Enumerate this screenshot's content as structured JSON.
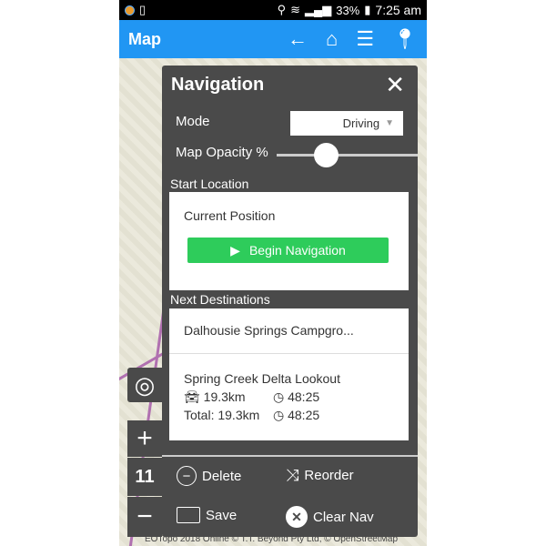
{
  "status_bar": {
    "battery": "33%",
    "time": "7:25 am"
  },
  "app_bar": {
    "title": "Map",
    "icons": [
      "arrow-left-icon",
      "home-icon",
      "list-icon",
      "pin-icon"
    ]
  },
  "navigation": {
    "title": "Navigation",
    "mode_label": "Mode",
    "mode_value": "Driving",
    "opacity_label": "Map Opacity %",
    "opacity_value": 35,
    "start_label": "Start Location",
    "start_value": "Current Position",
    "begin_label": "Begin Navigation",
    "next_label": "Next Destinations",
    "destinations": [
      {
        "name": "Dalhousie Springs Campgro..."
      },
      {
        "name": "Spring Creek Delta Lookout",
        "distance": "19.3km",
        "time": "48:25",
        "total_label": "Total: 19.3km",
        "total_time": "48:25"
      }
    ],
    "actions": {
      "delete": "Delete",
      "reorder": "Reorder",
      "save": "Save",
      "clear": "Clear Nav"
    }
  },
  "map_controls": {
    "zoom_level": "11"
  },
  "attribution": "EOTopo 2018 Online © T.T. Beyond Pty Ltd, © OpenStreetMap",
  "colors": {
    "app_bar": "#2196f3",
    "panel": "#4a4a4a",
    "begin": "#2ecc5b"
  }
}
